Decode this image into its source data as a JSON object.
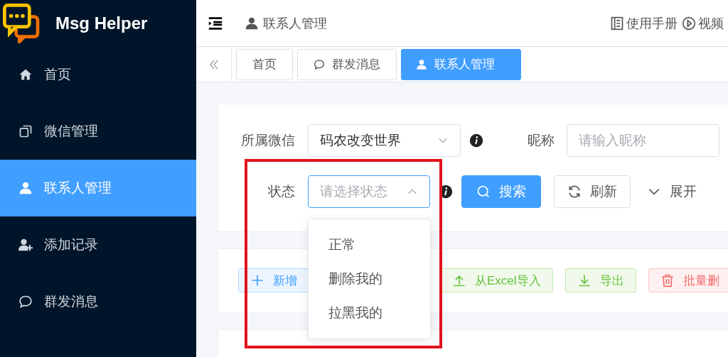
{
  "app": {
    "name": "Msg Helper"
  },
  "sidebar": {
    "items": [
      {
        "label": "首页",
        "selected": false
      },
      {
        "label": "微信管理",
        "selected": false
      },
      {
        "label": "联系人管理",
        "selected": true
      },
      {
        "label": "添加记录",
        "selected": false
      },
      {
        "label": "群发消息",
        "selected": false
      }
    ]
  },
  "header": {
    "breadcrumb": "联系人管理",
    "links": [
      "使用手册",
      "视频"
    ]
  },
  "tabs": [
    {
      "label": "首页",
      "selected": false
    },
    {
      "label": "群发消息",
      "selected": false
    },
    {
      "label": "联系人管理",
      "selected": true
    }
  ],
  "filters": [
    {
      "kind": "select",
      "label": "所属微信",
      "value": "码农改变世界",
      "expanded": false
    },
    {
      "kind": "input",
      "label": "昵称",
      "placeholder": "请输入昵称"
    },
    {
      "kind": "select",
      "label": "状态",
      "placeholder": "请选择状态",
      "expanded": true
    }
  ],
  "search_actions": [
    {
      "label": "搜索",
      "kind": "primary"
    },
    {
      "label": "刷新",
      "kind": "default"
    },
    {
      "label": "展开",
      "kind": "text"
    }
  ],
  "status_options": [
    "正常",
    "删除我的",
    "拉黑我的"
  ],
  "toolbar": [
    {
      "label": "新增",
      "kind": "primary"
    },
    {
      "label": "从Excel导入",
      "kind": "success"
    },
    {
      "label": "导出",
      "kind": "success"
    },
    {
      "label": "批量删",
      "kind": "danger"
    }
  ]
}
